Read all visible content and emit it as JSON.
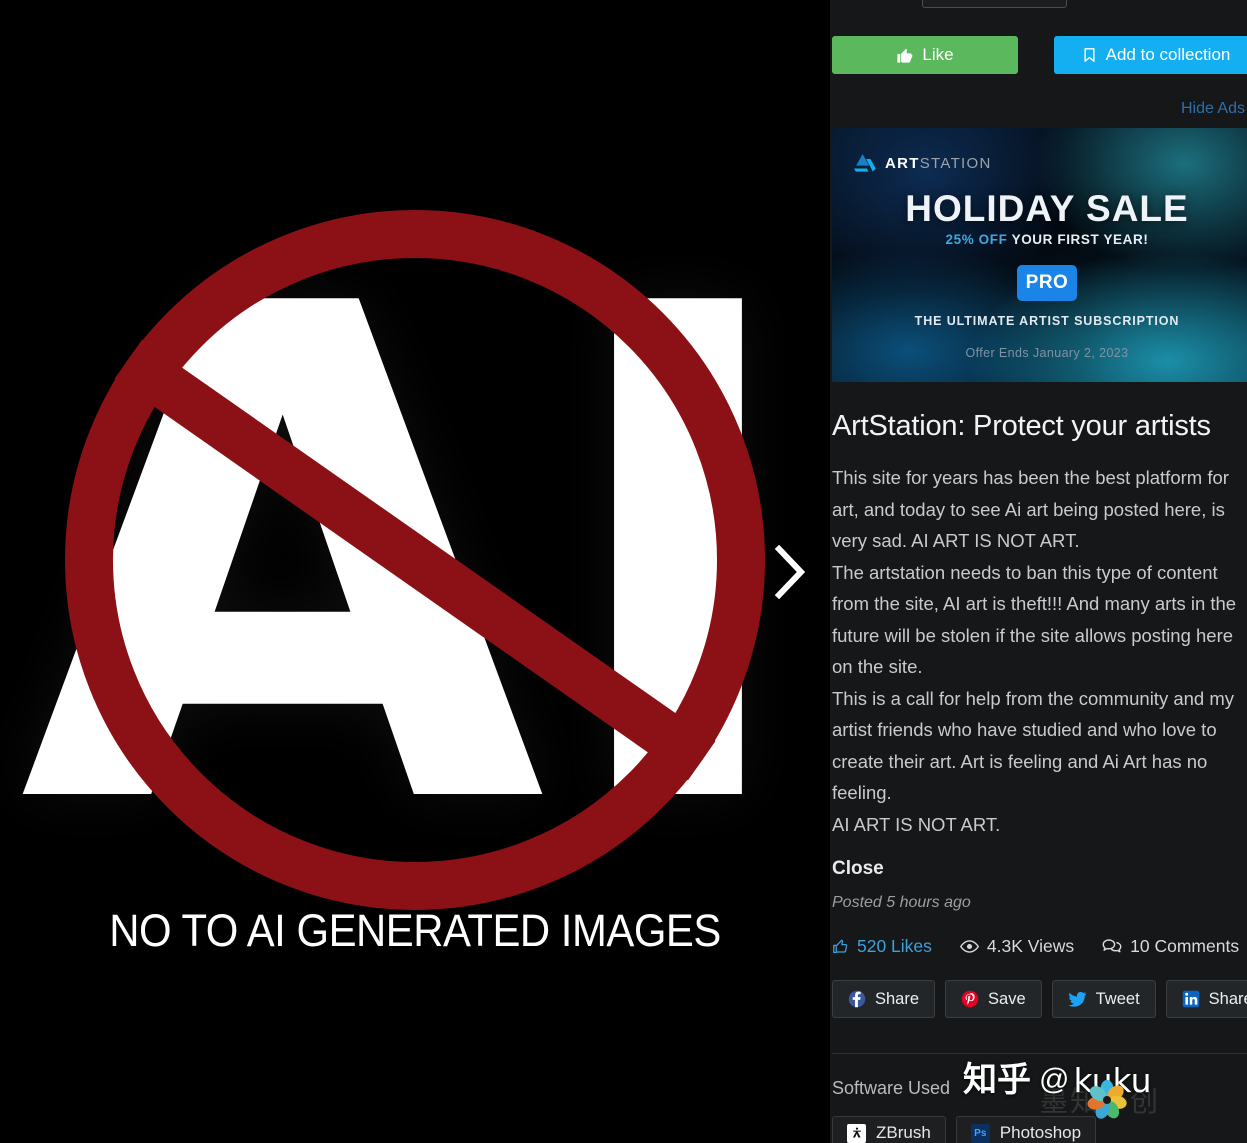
{
  "artwork": {
    "caption": "NO TO AI GENERATED IMAGES",
    "letters": "AI",
    "next_arrow_icon": "chevron-right-icon",
    "sign_color": "#8B1117",
    "background_color": "#000000"
  },
  "actions": {
    "like_label": "Like",
    "like_icon": "thumbs-up-icon",
    "like_color": "#5CB85C",
    "collect_label": "Add to collection",
    "collect_icon": "bookmark-icon",
    "collect_color": "#13AFF0",
    "hide_ads_label": "Hide Ads",
    "hide_ads_color": "#2F6EA8"
  },
  "ad": {
    "brand_bold": "ART",
    "brand_light": "STATION",
    "logo_icon": "artstation-logo-icon",
    "headline": "HOLIDAY SALE",
    "discount": "25% OFF",
    "discount_rest": "YOUR FIRST YEAR!",
    "badge": "PRO",
    "tagline": "THE ULTIMATE ARTIST SUBSCRIPTION",
    "offer_ends": "Offer Ends January 2, 2023",
    "accent_color": "#1A84E8"
  },
  "post": {
    "title": "ArtStation: Protect your artists",
    "description": "This site for years has been the best platform for art, and today to see Ai art being posted here, is very sad. AI ART IS NOT ART.\nThe artstation needs to ban this type of content from the site, AI art is theft!!! And many arts in the future will be stolen if the site allows posting here on the site.\nThis is a call for help from the community and my artist friends who have studied and who love to create their art. Art is feeling and Ai Art has no feeling.\nAI ART IS NOT ART.",
    "close_label": "Close",
    "posted": "Posted 5 hours ago"
  },
  "stats": {
    "likes": "520 Likes",
    "likes_icon": "thumbs-up-icon",
    "views": "4.3K Views",
    "views_icon": "eye-icon",
    "comments": "10 Comments",
    "comments_icon": "comment-bubbles-icon"
  },
  "share": [
    {
      "label": "Share",
      "icon": "facebook-icon",
      "color": "#3B5998"
    },
    {
      "label": "Save",
      "icon": "pinterest-icon",
      "color": "#E60023"
    },
    {
      "label": "Tweet",
      "icon": "twitter-icon",
      "color": "#1DA1F2"
    },
    {
      "label": "Share",
      "icon": "linkedin-icon",
      "color": "#0A66C2"
    }
  ],
  "software": {
    "label": "Software Used",
    "tags": [
      {
        "name": "ZBrush",
        "icon": "zbrush-icon",
        "abbr": "Z"
      },
      {
        "name": "Photoshop",
        "icon": "photoshop-icon",
        "abbr": "Ps"
      }
    ]
  },
  "watermark": {
    "site": "知乎",
    "at": "@",
    "user": "kuku",
    "ghost": "墨知乎创"
  }
}
